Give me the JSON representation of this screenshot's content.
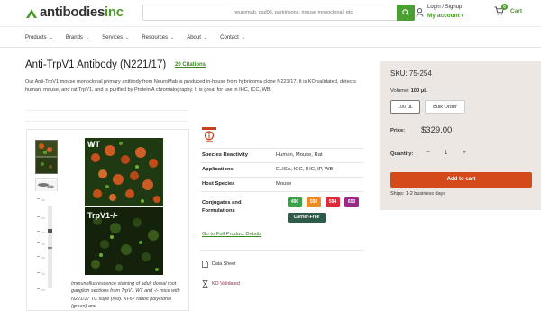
{
  "header": {
    "logo": {
      "brand": "antibodies",
      "suffix": "inc"
    },
    "search": {
      "placeholder": "neuromab, psd95, parkinsons, mouse monoclonal, etc."
    },
    "account": {
      "line1": "Login / Signup",
      "line2": "My account"
    },
    "cart": {
      "label": "Cart",
      "count": "0"
    }
  },
  "nav": {
    "items": [
      {
        "label": "Products"
      },
      {
        "label": "Brands"
      },
      {
        "label": "Services"
      },
      {
        "label": "Resources"
      },
      {
        "label": "About"
      },
      {
        "label": "Contact"
      }
    ]
  },
  "product": {
    "title": "Anti-TrpV1 Antibody (N221/17)",
    "citations": "20 Citations",
    "description": "Our Anti-TrpV1 mouse monoclonal primary antibody from NeuroMab is produced in-house from hybridoma clone N221/17. It is KO validated, detects human, mouse, and rat TrpV1, and is purified by Protein A chromatography. It is great for use in IHC, ICC, WB."
  },
  "gallery": {
    "panel_top_label": "WT",
    "panel_bottom_label": "TrpV1-/-",
    "caption": "Immunofluorescence staining of adult dorsal root ganglion sections from TrpV1 WT and -/- mice with N221/17 TC supe (red). Ki-67 rabbit polyclonal (green) and"
  },
  "specs": {
    "brand_icon": "neuromab-logo",
    "rows": [
      {
        "label": "Species Reactivity",
        "value": "Human, Mouse, Rat"
      },
      {
        "label": "Applications",
        "value": "ELISA, ICC, IHC, IP, WB"
      },
      {
        "label": "Host Species",
        "value": "Mouse"
      }
    ],
    "conjugates_label_1": "Conjugates and",
    "conjugates_label_2": "Formulations",
    "chips": [
      {
        "label": "490",
        "color": "#3aa348"
      },
      {
        "label": "550",
        "color": "#f08a22"
      },
      {
        "label": "594",
        "color": "#e02a3a"
      },
      {
        "label": "650",
        "color": "#9a2a8a"
      }
    ],
    "carrier_free": {
      "label": "Carrier-Free",
      "color": "#2e5a4a"
    },
    "full_details_link": "Go to Full Product Details",
    "data_sheet": "Data Sheet",
    "ko_validated": "KO Validated"
  },
  "purchase": {
    "sku": "SKU: 75-254",
    "volume_label": "Volume:",
    "volume_value": "100 µL",
    "options": [
      {
        "label": "100 µL",
        "selected": true
      },
      {
        "label": "Bulk Order",
        "selected": false
      }
    ],
    "price_label": "Price:",
    "price": "$329.00",
    "quantity_label": "Quantity:",
    "quantity": "1",
    "minus": "−",
    "plus": "+",
    "add_to_cart": "Add to cart",
    "ships": "Ships: 1-2 business days"
  },
  "colors": {
    "brand_green": "#4aa030",
    "add_cart": "#d44a1a",
    "panel_bg": "#ede7e3"
  }
}
